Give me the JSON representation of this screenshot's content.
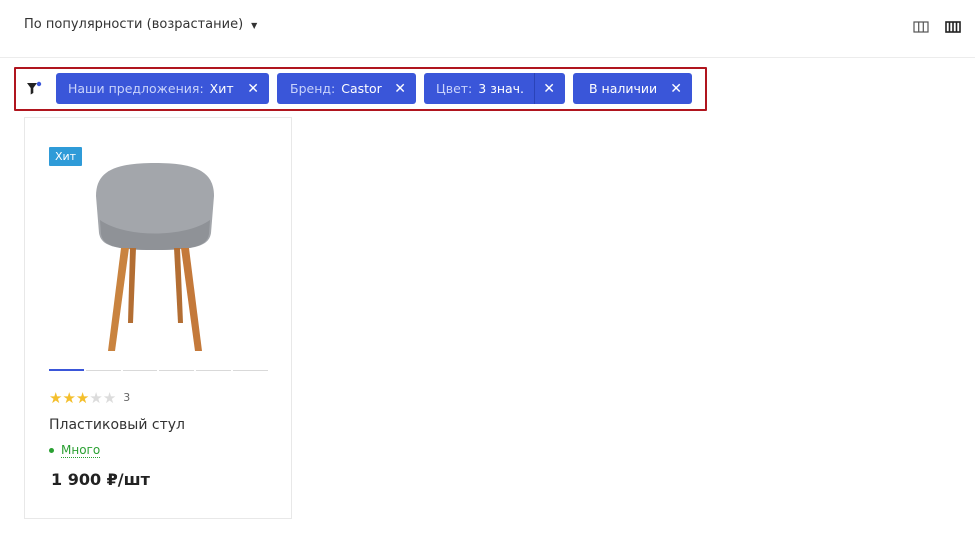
{
  "sort": {
    "label": "По популярности (возрастание)",
    "caret_icon": "caret-down-icon"
  },
  "view_modes": [
    {
      "icon": "grid-view-icon"
    },
    {
      "icon": "list-view-icon"
    }
  ],
  "filters": {
    "icon": "filter-icon",
    "chips": [
      {
        "key": "Наши предложения:",
        "value": "Хит"
      },
      {
        "key": "Бренд:",
        "value": "Castor"
      },
      {
        "key": "Цвет:",
        "value": "3 знач."
      },
      {
        "key": "",
        "value": "В наличии"
      }
    ],
    "remove_glyph": "✕"
  },
  "product": {
    "badge": "Хит",
    "image_icon": "chair-image",
    "slider_count": 6,
    "slider_active": 0,
    "rating": 3,
    "rating_max": 5,
    "reviews_count": "3",
    "title": "Пластиковый стул",
    "stock": "Много",
    "price": "1 900 ₽/шт"
  },
  "colors": {
    "accent": "#3a56d9",
    "badge": "#2f9bd8",
    "highlight_border": "#b0151e",
    "in_stock": "#2aa032",
    "star_on": "#f4bf2c",
    "star_off": "#dcdcdc"
  }
}
